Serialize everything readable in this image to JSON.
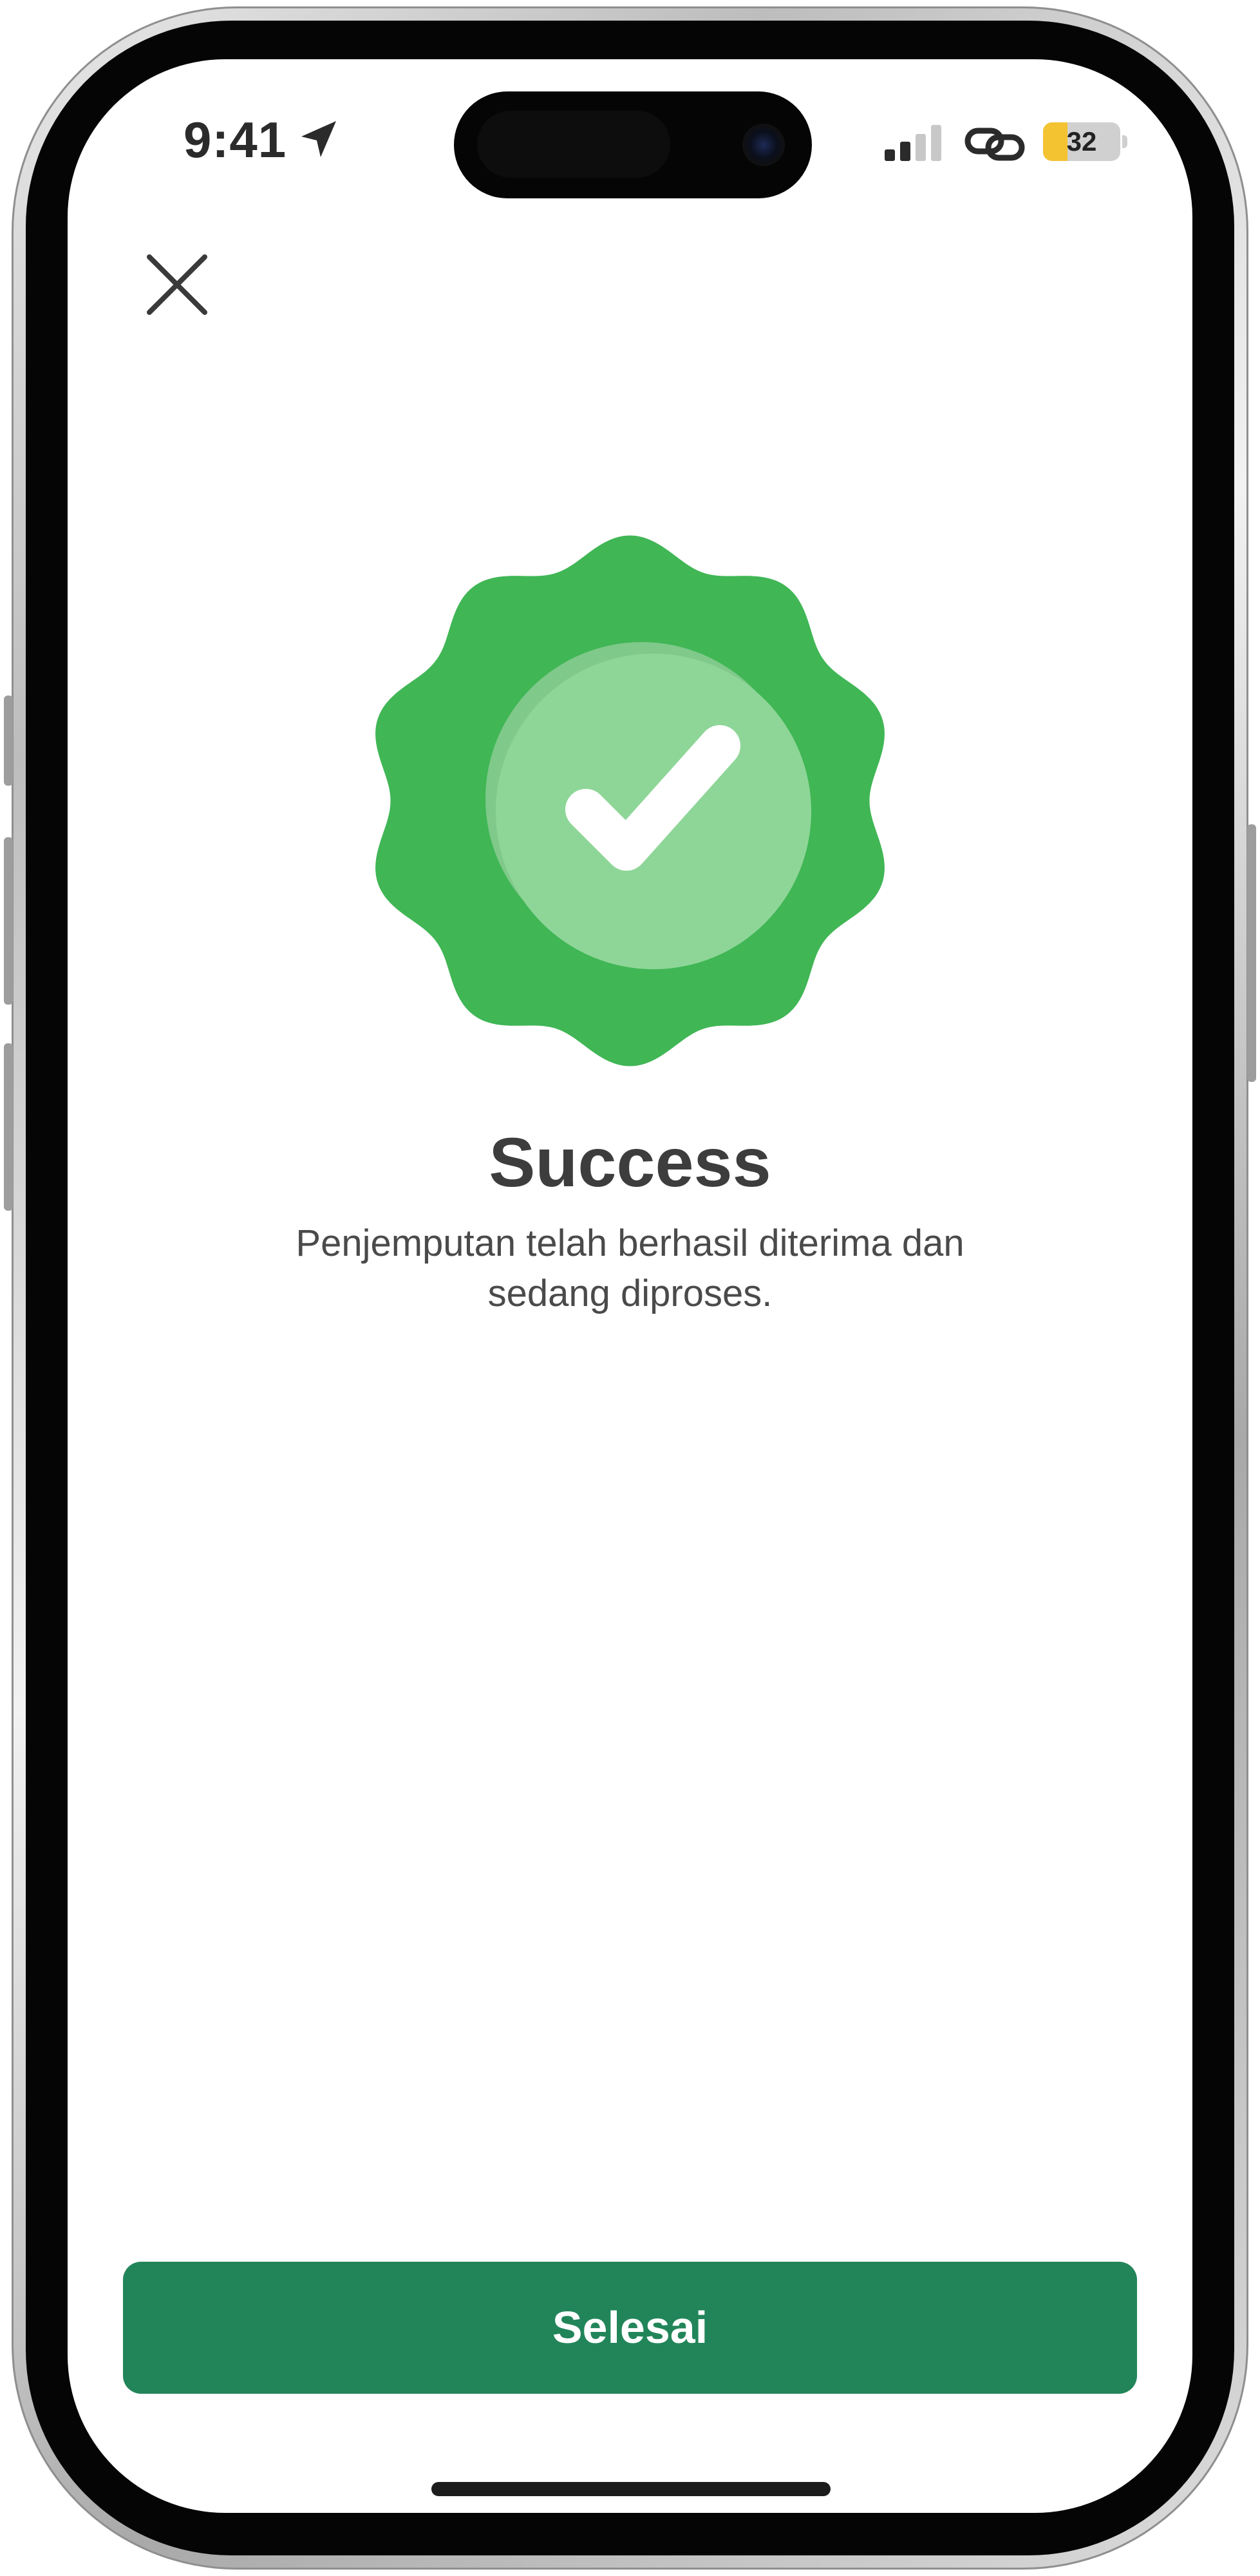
{
  "status_bar": {
    "time": "9:41",
    "battery_percent": "32",
    "battery_level": 0.32,
    "location_icon": "location-arrow-icon",
    "signal_icon": "signal-bars-icon",
    "link_icon": "link-icon"
  },
  "header": {
    "close_icon": "close-icon"
  },
  "success": {
    "badge_icon": "success-badge-icon",
    "title": "Success",
    "message": "Penjemputan telah berhasil diterima dan sedang diproses."
  },
  "footer": {
    "done_label": "Selesai"
  },
  "colors": {
    "badge_green": "#40b655",
    "badge_inner": "#8ed698",
    "button_green": "#22855a",
    "battery_yellow": "#f4c331",
    "text_dark": "#3d3d3d"
  }
}
